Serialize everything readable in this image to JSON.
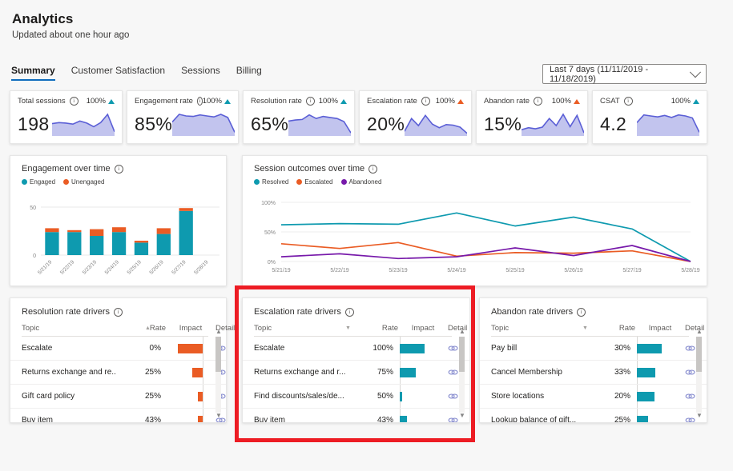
{
  "header": {
    "title": "Analytics",
    "subtitle": "Updated about one hour ago"
  },
  "tabs": [
    {
      "label": "Summary",
      "active": true
    },
    {
      "label": "Customer Satisfaction",
      "active": false
    },
    {
      "label": "Sessions",
      "active": false
    },
    {
      "label": "Billing",
      "active": false
    }
  ],
  "date_filter": {
    "label": "Last 7 days (11/11/2019 - 11/18/2019)",
    "icon": "chevron-down-icon"
  },
  "kpis": [
    {
      "label": "Total sessions",
      "value": "198",
      "delta": "100%",
      "trend": "up",
      "trend_color": "#0e9aaf",
      "info_icon": "info-icon"
    },
    {
      "label": "Engagement rate",
      "value": "85%",
      "delta": "100%",
      "trend": "up",
      "trend_color": "#0e9aaf",
      "info_icon": "info-icon"
    },
    {
      "label": "Resolution rate",
      "value": "65%",
      "delta": "100%",
      "trend": "up",
      "trend_color": "#0e9aaf",
      "info_icon": "info-icon"
    },
    {
      "label": "Escalation rate",
      "value": "20%",
      "delta": "100%",
      "trend": "up",
      "trend_color": "#ea5c24",
      "info_icon": "info-icon"
    },
    {
      "label": "Abandon rate",
      "value": "15%",
      "delta": "100%",
      "trend": "up",
      "trend_color": "#ea5c24",
      "info_icon": "info-icon"
    },
    {
      "label": "CSAT",
      "value": "4.2",
      "delta": "100%",
      "trend": "up",
      "trend_color": "#0e9aaf",
      "info_icon": "info-icon"
    }
  ],
  "chart_data": [
    {
      "type": "line",
      "name": "kpi-sparkline-total-sessions",
      "title": "Total sessions",
      "values": [
        42,
        46,
        44,
        40,
        52,
        44,
        30,
        46,
        78,
        10
      ],
      "ylim": [
        0,
        100
      ],
      "fill": "#aeb0e8",
      "stroke": "#5b5fd6"
    },
    {
      "type": "line",
      "name": "kpi-sparkline-engagement-rate",
      "title": "Engagement rate",
      "values": [
        48,
        78,
        72,
        70,
        76,
        72,
        68,
        78,
        66,
        8
      ],
      "ylim": [
        0,
        100
      ],
      "fill": "#aeb0e8",
      "stroke": "#5b5fd6"
    },
    {
      "type": "line",
      "name": "kpi-sparkline-resolution-rate",
      "title": "Resolution rate",
      "values": [
        52,
        56,
        58,
        76,
        62,
        70,
        66,
        62,
        50,
        6
      ],
      "ylim": [
        0,
        100
      ],
      "fill": "#aeb0e8",
      "stroke": "#5b5fd6"
    },
    {
      "type": "line",
      "name": "kpi-sparkline-escalation-rate",
      "title": "Escalation rate",
      "values": [
        12,
        62,
        34,
        74,
        40,
        26,
        38,
        36,
        28,
        4
      ],
      "ylim": [
        0,
        100
      ],
      "fill": "#aeb0e8",
      "stroke": "#5b5fd6"
    },
    {
      "type": "line",
      "name": "kpi-sparkline-abandon-rate",
      "title": "Abandon rate",
      "values": [
        18,
        26,
        22,
        28,
        62,
        34,
        78,
        30,
        74,
        6
      ],
      "ylim": [
        0,
        100
      ],
      "fill": "#aeb0e8",
      "stroke": "#5b5fd6"
    },
    {
      "type": "line",
      "name": "kpi-sparkline-csat",
      "title": "CSAT",
      "values": [
        46,
        76,
        72,
        68,
        74,
        66,
        76,
        72,
        64,
        8
      ],
      "ylim": [
        0,
        100
      ],
      "fill": "#aeb0e8",
      "stroke": "#5b5fd6"
    },
    {
      "type": "bar",
      "name": "engagement-over-time",
      "title": "Engagement over time",
      "stacked": true,
      "categories": [
        "5/21/19",
        "5/22/19",
        "5/23/19",
        "5/24/19",
        "5/25/19",
        "5/26/19",
        "5/27/19",
        "5/28/19"
      ],
      "series": [
        {
          "name": "Engaged",
          "color": "#0e9aaf",
          "values": [
            24,
            24,
            20,
            24,
            13,
            22,
            46,
            0
          ]
        },
        {
          "name": "Unengaged",
          "color": "#ea5c24",
          "values": [
            4,
            2,
            7,
            5,
            2,
            6,
            3,
            0
          ]
        }
      ],
      "yticks": [
        "0",
        "50"
      ],
      "ylim": [
        0,
        55
      ],
      "ylabel": "",
      "xlabel": "",
      "grid": true,
      "legend_position": "top-left"
    },
    {
      "type": "line",
      "name": "session-outcomes-over-time",
      "title": "Session outcomes over time",
      "categories": [
        "5/21/19",
        "5/22/19",
        "5/23/19",
        "5/24/19",
        "5/25/19",
        "5/26/19",
        "5/27/19",
        "5/28/19"
      ],
      "series": [
        {
          "name": "Resolved",
          "color": "#0e9aaf",
          "values": [
            62,
            64,
            63,
            82,
            60,
            75,
            55,
            0
          ]
        },
        {
          "name": "Escalated",
          "color": "#ea5c24",
          "values": [
            30,
            22,
            32,
            9,
            15,
            14,
            18,
            0
          ]
        },
        {
          "name": "Abandoned",
          "color": "#7719aa",
          "values": [
            8,
            13,
            5,
            8,
            23,
            10,
            27,
            0
          ]
        }
      ],
      "yticks": [
        "0%",
        "50%",
        "100%"
      ],
      "ylim": [
        0,
        100
      ],
      "ylabel": "",
      "xlabel": "",
      "grid": true,
      "legend_position": "top-left"
    }
  ],
  "tables": [
    {
      "name": "resolution-rate-drivers",
      "title": "Resolution rate drivers",
      "columns": [
        "Topic",
        "Rate",
        "Impact",
        "Detail"
      ],
      "sort_column": "Rate",
      "sort_direction": "asc",
      "bar_color": "#ea5c24",
      "bar_direction": "left",
      "rows": [
        {
          "topic": "Escalate",
          "rate": "0%",
          "impact": 100,
          "detail_icon": "link-icon"
        },
        {
          "topic": "Returns exchange and re...",
          "rate": "25%",
          "impact": 42,
          "detail_icon": "link-icon"
        },
        {
          "topic": "Gift card policy",
          "rate": "25%",
          "impact": 20,
          "detail_icon": "link-icon"
        },
        {
          "topic": "Buy item",
          "rate": "43%",
          "impact": 18,
          "detail_icon": "link-icon"
        }
      ]
    },
    {
      "name": "escalation-rate-drivers",
      "title": "Escalation rate drivers",
      "columns": [
        "Topic",
        "Rate",
        "Impact",
        "Detail"
      ],
      "sort_column": "Rate",
      "sort_direction": "desc",
      "bar_color": "#0e9aaf",
      "bar_direction": "right",
      "rows": [
        {
          "topic": "Escalate",
          "rate": "100%",
          "impact": 100,
          "detail_icon": "link-icon"
        },
        {
          "topic": "Returns exchange and r...",
          "rate": "75%",
          "impact": 64,
          "detail_icon": "link-icon"
        },
        {
          "topic": "Find discounts/sales/de...",
          "rate": "50%",
          "impact": 9,
          "detail_icon": "link-icon"
        },
        {
          "topic": "Buy item",
          "rate": "43%",
          "impact": 26,
          "detail_icon": "link-icon"
        }
      ]
    },
    {
      "name": "abandon-rate-drivers",
      "title": "Abandon rate drivers",
      "columns": [
        "Topic",
        "Rate",
        "Impact",
        "Detail"
      ],
      "sort_column": "Rate",
      "sort_direction": "desc",
      "bar_color": "#0e9aaf",
      "bar_direction": "right",
      "rows": [
        {
          "topic": "Pay bill",
          "rate": "30%",
          "impact": 100,
          "detail_icon": "link-icon"
        },
        {
          "topic": "Cancel Membership",
          "rate": "33%",
          "impact": 73,
          "detail_icon": "link-icon"
        },
        {
          "topic": "Store locations",
          "rate": "20%",
          "impact": 70,
          "detail_icon": "link-icon"
        },
        {
          "topic": "Lookup balance of gift...",
          "rate": "25%",
          "impact": 44,
          "detail_icon": "link-icon"
        }
      ]
    }
  ],
  "highlight": {
    "name": "focus-rectangle",
    "color": "#ed1c24"
  }
}
